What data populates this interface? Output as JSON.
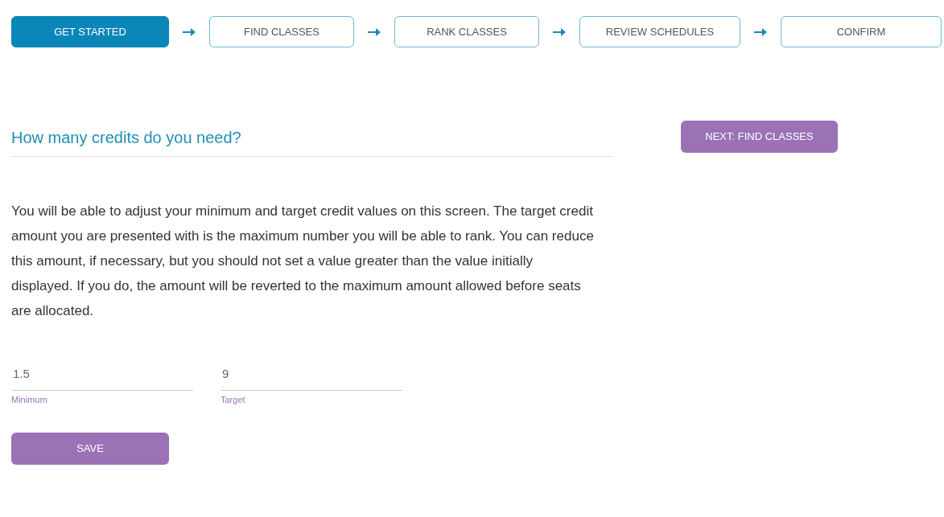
{
  "steps": [
    {
      "label": "GET STARTED",
      "selected": true
    },
    {
      "label": "FIND CLASSES",
      "selected": false
    },
    {
      "label": "RANK CLASSES",
      "selected": false
    },
    {
      "label": "REVIEW SCHEDULES",
      "selected": false
    },
    {
      "label": "CONFIRM",
      "selected": false
    }
  ],
  "heading": "How many credits do you need?",
  "next_button": "NEXT: FIND CLASSES",
  "description": "You will be able to adjust your minimum and target credit values on this screen. The target credit amount you are presented with is the maximum number you will be able to rank. You can reduce this amount, if necessary, but you should not set a value greater than the value initially displayed. If you do, the amount will be reverted to the maximum amount allowed before seats are allocated.",
  "fields": [
    {
      "label": "Minimum",
      "value": "1.5"
    },
    {
      "label": "Target",
      "value": "9"
    }
  ],
  "save_button": "SAVE"
}
